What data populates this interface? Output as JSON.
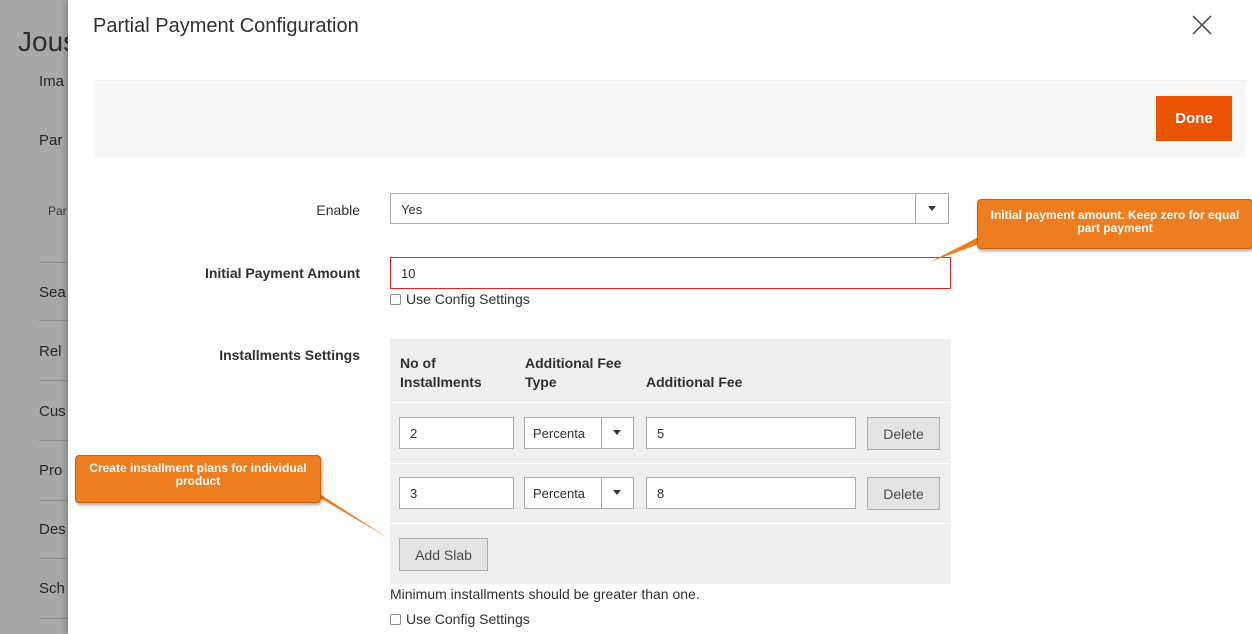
{
  "background": {
    "title": "Jous",
    "items": [
      "Ima",
      "Par",
      "Par",
      "Sea",
      "Rel",
      "Cus",
      "Pro",
      "Des",
      "Sch"
    ]
  },
  "modal": {
    "title": "Partial Payment Configuration",
    "close_icon": "close-icon",
    "done_label": "Done"
  },
  "form": {
    "enable": {
      "label": "Enable",
      "value": "Yes"
    },
    "initial_payment": {
      "label": "Initial Payment Amount",
      "value": "10",
      "use_config_label": "Use Config Settings"
    },
    "installments": {
      "label": "Installments Settings",
      "columns": [
        "No of Installments",
        "Additional Fee Type",
        "Additional Fee"
      ],
      "rows": [
        {
          "count": "2",
          "fee_type": "Percenta",
          "fee": "5",
          "delete_label": "Delete"
        },
        {
          "count": "3",
          "fee_type": "Percenta",
          "fee": "8",
          "delete_label": "Delete"
        }
      ],
      "add_label": "Add Slab",
      "note": "Minimum installments should be greater than one.",
      "use_config_label": "Use Config Settings"
    }
  },
  "callouts": {
    "initial": "Initial payment amount. Keep zero for equal part payment",
    "installment": "Create installment plans for individual product"
  },
  "colors": {
    "accent": "#eb5202",
    "callout": "#ed7d1f",
    "error_border": "#e22626"
  }
}
